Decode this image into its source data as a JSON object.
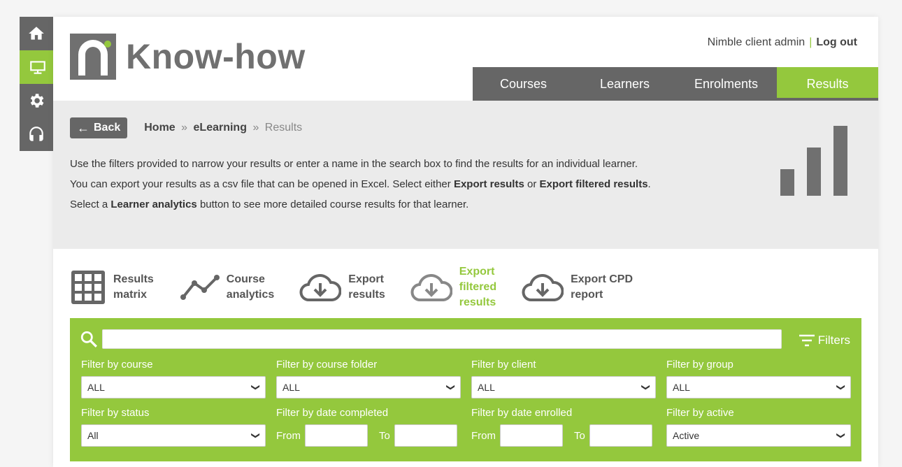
{
  "rail": {
    "items": [
      {
        "name": "home",
        "icon": "home-icon"
      },
      {
        "name": "elearning",
        "icon": "monitor-icon",
        "active": true
      },
      {
        "name": "settings",
        "icon": "gear-icon"
      },
      {
        "name": "support",
        "icon": "headset-icon"
      }
    ]
  },
  "brand": {
    "name": "Know-how"
  },
  "user": {
    "name": "Nimble client admin",
    "separator": "|",
    "logout": "Log out"
  },
  "nav": {
    "tabs": [
      {
        "label": "Courses"
      },
      {
        "label": "Learners"
      },
      {
        "label": "Enrolments"
      },
      {
        "label": "Results",
        "active": true
      }
    ]
  },
  "breadcrumb": {
    "back": "Back",
    "home": "Home",
    "sep": "»",
    "elearning": "eLearning",
    "current": "Results"
  },
  "intro": {
    "p1": "Use the filters provided to narrow your results or enter a name in the search box to find the results for an individual learner.",
    "p2_a": "You can export your results as a csv file that can be opened in Excel. Select either ",
    "p2_b": "Export results",
    "p2_c": " or ",
    "p2_d": "Export filtered results",
    "p2_e": ".",
    "p3_a": "Select a ",
    "p3_b": "Learner analytics",
    "p3_c": " button to see more detailed course results for that learner."
  },
  "actions": [
    {
      "line1": "Results",
      "line2": "matrix",
      "line3": "",
      "icon": "grid-icon"
    },
    {
      "line1": "Course",
      "line2": "analytics",
      "line3": "",
      "icon": "line-chart-icon"
    },
    {
      "line1": "Export",
      "line2": "results",
      "line3": "",
      "icon": "cloud-download-icon"
    },
    {
      "line1": "Export",
      "line2": "filtered",
      "line3": "results",
      "icon": "cloud-download-icon",
      "active": true
    },
    {
      "line1": "Export CPD",
      "line2": "report",
      "line3": "",
      "icon": "cloud-download-icon"
    }
  ],
  "search": {
    "value": "",
    "filters_label": "Filters"
  },
  "filters": {
    "course": {
      "label": "Filter by course",
      "value": "ALL"
    },
    "folder": {
      "label": "Filter by course folder",
      "value": "ALL"
    },
    "client": {
      "label": "Filter by client",
      "value": "ALL"
    },
    "group": {
      "label": "Filter by group",
      "value": "ALL"
    },
    "status": {
      "label": "Filter by status",
      "value": "All"
    },
    "completed": {
      "label": "Filter by date completed",
      "from": "From",
      "to": "To"
    },
    "enrolled": {
      "label": "Filter by date enrolled",
      "from": "From",
      "to": "To"
    },
    "active": {
      "label": "Filter by active",
      "value": "Active"
    }
  },
  "colors": {
    "accent": "#94c83d",
    "dark": "#666666"
  }
}
